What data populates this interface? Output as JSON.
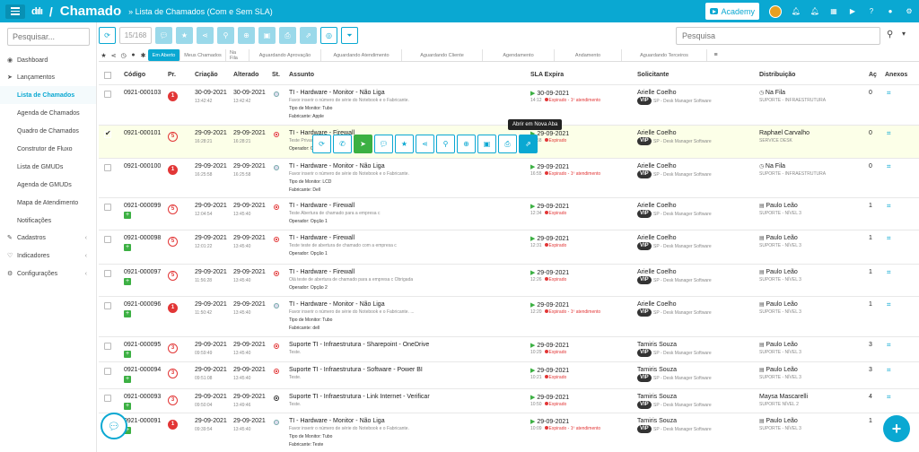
{
  "header": {
    "logo": "dılı",
    "slash": "/",
    "title": "Chamado",
    "subtitle": "» Lista de Chamados (Com e Sem SLA)",
    "academy_label": "Academy"
  },
  "sidebar": {
    "search_placeholder": "Pesquisar...",
    "items": [
      {
        "label": "Dashboard",
        "icon": "dashboard-icon",
        "glyph": "◉"
      },
      {
        "label": "Lançamentos",
        "icon": "send-icon",
        "glyph": "➤"
      },
      {
        "label": "Lista de Chamados"
      },
      {
        "label": "Agenda de Chamados"
      },
      {
        "label": "Quadro de Chamados"
      },
      {
        "label": "Construtor de Fluxo"
      },
      {
        "label": "Lista de GMUDs"
      },
      {
        "label": "Agenda de GMUDs"
      },
      {
        "label": "Mapa de Atendimento"
      },
      {
        "label": "Notificações"
      },
      {
        "label": "Cadastros",
        "icon": "edit-icon",
        "glyph": "✎"
      },
      {
        "label": "Indicadores",
        "icon": "heart-icon",
        "glyph": "♡"
      },
      {
        "label": "Configurações",
        "icon": "gear-icon",
        "glyph": "⚙"
      }
    ]
  },
  "toolbar": {
    "count": "15/168",
    "search_placeholder": "Pesquisa"
  },
  "filters": [
    "Em Aberto",
    "Meus Chamados",
    "Na Fila",
    "Aguardando Aprovação",
    "Aguardando Atendimento",
    "Aguardando Cliente",
    "Agendamento",
    "Andamento",
    "Aguardando Terceiros"
  ],
  "table": {
    "columns": [
      "Código",
      "Pr.",
      "Criação",
      "Alterado",
      "St.",
      "Assunto",
      "SLA Expira",
      "Solicitante",
      "Distribuição",
      "Aç",
      "Anexos"
    ],
    "rows": [
      {
        "code": "0921-000103",
        "prio": "1",
        "created": "30-09-2021",
        "created_t": "13:42:42",
        "altered": "30-09-2021",
        "altered_t": "13:42:42",
        "subject": "TI - Hardware - Monitor - Não Liga",
        "desc": "Favor inserir o número de série do Notebook e o Fabricante.",
        "meta1": "Tipo de Monitor: Tubo",
        "meta2": "Fabricante: Apple",
        "sla": "30-09-2021",
        "sla_t": "14:12",
        "sla_exp": "Expirado - 1º atendimento",
        "req": "Arielle Coelho",
        "vip": "VIP",
        "vip_text": "SP - Desk Manager Software",
        "dist": "Na Fila",
        "dist2": "SUPORTE - INFRAESTRUTURA",
        "ac": "0"
      },
      {
        "code": "0921-000101",
        "prio": "5",
        "created": "29-09-2021",
        "created_t": "16:28:21",
        "altered": "29-09-2021",
        "altered_t": "16:28:21",
        "subject": "TI - Hardware - Firewall",
        "desc": "Teste Privacidade",
        "meta1": "Operador: Opção 1",
        "sla": "29-09-2021",
        "sla_t": "16:58",
        "sla_exp": "Expirado",
        "req": "Arielle Coelho",
        "vip": "VIP",
        "vip_text": "SP - Desk Manager Software",
        "dist": "Raphael Carvalho",
        "dist2": "SERVICE DESK",
        "ac": "0"
      },
      {
        "code": "0921-000100",
        "prio": "1",
        "created": "29-09-2021",
        "created_t": "16:25:58",
        "altered": "29-09-2021",
        "altered_t": "16:25:58",
        "subject": "TI - Hardware - Monitor - Não Liga",
        "desc": "Favor inserir o número de série do Notebook e o Fabricante.",
        "meta1": "Tipo de Monitor: LCD",
        "meta2": "Fabricante: Dell",
        "sla": "29-09-2021",
        "sla_t": "16:55",
        "sla_exp": "Expirado - 1º atendimento",
        "req": "Arielle Coelho",
        "vip": "VIP",
        "vip_text": "SP - Desk Manager Software",
        "dist": "Na Fila",
        "dist2": "SUPORTE - INFRAESTRUTURA",
        "ac": "0"
      },
      {
        "code": "0921-000099",
        "prio": "5",
        "created": "29-09-2021",
        "created_t": "12:04:54",
        "altered": "29-09-2021",
        "altered_t": "13:45:40",
        "subject": "TI - Hardware - Firewall",
        "desc": "Teste Abertura de chamado para a empresa c",
        "meta1": "Operador: Opção 1",
        "sla": "29-09-2021",
        "sla_t": "12:34",
        "sla_exp": "Expirado",
        "req": "Arielle Coelho",
        "vip": "VIP",
        "vip_text": "SP - Desk Manager Software",
        "dist": "Paulo Leão",
        "dist2": "SUPORTE - NÍVEL 3",
        "ac": "1"
      },
      {
        "code": "0921-000098",
        "prio": "5",
        "created": "29-09-2021",
        "created_t": "12:01:22",
        "altered": "29-09-2021",
        "altered_t": "13:45:40",
        "subject": "TI - Hardware - Firewall",
        "desc": "Teste teste de abertura de chamado com a empresa c",
        "meta1": "Operador: Opção 1",
        "sla": "29-09-2021",
        "sla_t": "12:31",
        "sla_exp": "Expirado",
        "req": "Arielle Coelho",
        "vip": "VIP",
        "vip_text": "SP - Desk Manager Software",
        "dist": "Paulo Leão",
        "dist2": "SUPORTE - NÍVEL 3",
        "ac": "1"
      },
      {
        "code": "0921-000097",
        "prio": "5",
        "created": "29-09-2021",
        "created_t": "11:56:28",
        "altered": "29-09-2021",
        "altered_t": "13:45:40",
        "subject": "TI - Hardware - Firewall",
        "desc": "Olá teste de abertura de chamado para a empresa c Obrigada",
        "meta1": "Operador: Opção 2",
        "sla": "29-09-2021",
        "sla_t": "12:26",
        "sla_exp": "Expirado",
        "req": "Arielle Coelho",
        "vip": "VIP",
        "vip_text": "SP - Desk Manager Software",
        "dist": "Paulo Leão",
        "dist2": "SUPORTE - NÍVEL 3",
        "ac": "1"
      },
      {
        "code": "0921-000096",
        "prio": "1",
        "created": "29-09-2021",
        "created_t": "11:50:42",
        "altered": "29-09-2021",
        "altered_t": "13:45:40",
        "subject": "TI - Hardware - Monitor - Não Liga",
        "desc": "Favor inserir o número de série do Notebook e o Fabricante. ...",
        "meta1": "Tipo de Monitor: Tubo",
        "meta2": "Fabricante: dell",
        "sla": "29-09-2021",
        "sla_t": "12:20",
        "sla_exp": "Expirado - 1º atendimento",
        "req": "Arielle Coelho",
        "vip": "VIP",
        "vip_text": "SP - Desk Manager Software",
        "dist": "Paulo Leão",
        "dist2": "SUPORTE - NÍVEL 3",
        "ac": "1"
      },
      {
        "code": "0921-000095",
        "prio": "3",
        "created": "29-09-2021",
        "created_t": "09:59:49",
        "altered": "29-09-2021",
        "altered_t": "13:45:40",
        "subject": "Suporte TI - Infraestrutura - Sharepoint - OneDrive",
        "desc": "Teste.",
        "sla": "29-09-2021",
        "sla_t": "10:29",
        "sla_exp": "Expirado",
        "req": "Tamiris Souza",
        "vip": "VIP",
        "vip_text": "SP - Desk Manager Software",
        "dist": "Paulo Leão",
        "dist2": "SUPORTE - NÍVEL 3",
        "ac": "3"
      },
      {
        "code": "0921-000094",
        "prio": "3",
        "created": "29-09-2021",
        "created_t": "09:51:08",
        "altered": "29-09-2021",
        "altered_t": "13:45:40",
        "subject": "Suporte TI - Infraestrutura - Software - Power BI",
        "desc": "Teste.",
        "sla": "29-09-2021",
        "sla_t": "10:21",
        "sla_exp": "Expirado",
        "req": "Tamiris Souza",
        "vip": "VIP",
        "vip_text": "SP - Desk Manager Software",
        "dist": "Paulo Leão",
        "dist2": "SUPORTE - NÍVEL 3",
        "ac": "3"
      },
      {
        "code": "0921-000093",
        "prio": "3",
        "created": "29-09-2021",
        "created_t": "09:50:04",
        "altered": "29-09-2021",
        "altered_t": "13:49:46",
        "subject": "Suporte TI - Infraestrutura - Link Internet - Verificar",
        "desc": "Teste.",
        "sla": "29-09-2021",
        "sla_t": "10:50",
        "sla_exp": "Expirado",
        "req": "Tamiris Souza",
        "vip": "VIP",
        "vip_text": "SP - Desk Manager Software",
        "dist": "Maysa Mascarelli",
        "dist2": "SUPORTE NÍVEL 2",
        "ac": "4"
      },
      {
        "code": "0921-000091",
        "prio": "1",
        "created": "29-09-2021",
        "created_t": "09:39:54",
        "altered": "29-09-2021",
        "altered_t": "13:45:40",
        "subject": "TI - Hardware - Monitor - Não Liga",
        "desc": "Favor inserir o número de série do Notebook e o Fabricante.",
        "meta1": "Tipo de Monitor: Tubo",
        "meta2": "Fabricante: Teste",
        "sla": "29-09-2021",
        "sla_t": "10:09",
        "sla_exp": "Expirado - 1º atendimento",
        "req": "Tamiris Souza",
        "vip": "VIP",
        "vip_text": "SP - Desk Manager Software",
        "dist": "Paulo Leão",
        "dist2": "SUPORTE - NÍVEL 3",
        "ac": "1"
      }
    ]
  },
  "tooltip": "Abrir em Nova Aba"
}
